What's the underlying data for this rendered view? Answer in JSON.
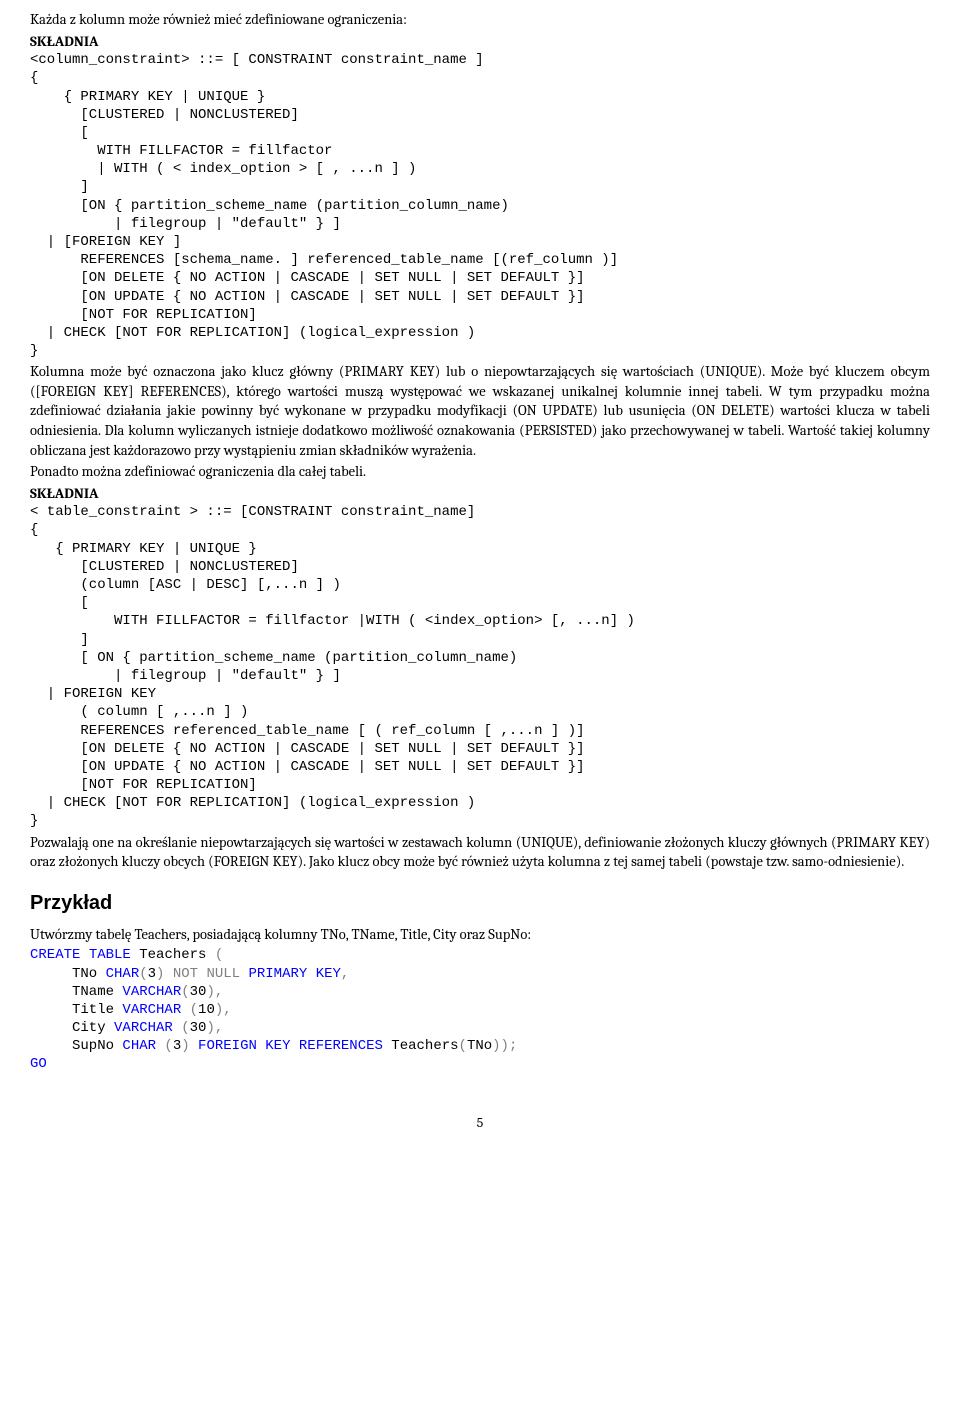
{
  "p1": "Każda z kolumn może również mieć zdefiniowane ograniczenia:",
  "skladnia": "SKŁADNIA",
  "code1": "<column_constraint> ::= [ CONSTRAINT constraint_name ]\n{\n    { PRIMARY KEY | UNIQUE }\n      [CLUSTERED | NONCLUSTERED]\n      [\n        WITH FILLFACTOR = fillfactor\n        | WITH ( < index_option > [ , ...n ] )\n      ]\n      [ON { partition_scheme_name (partition_column_name)\n          | filegroup | \"default\" } ]\n  | [FOREIGN KEY ]\n      REFERENCES [schema_name. ] referenced_table_name [(ref_column )]\n      [ON DELETE { NO ACTION | CASCADE | SET NULL | SET DEFAULT }]\n      [ON UPDATE { NO ACTION | CASCADE | SET NULL | SET DEFAULT }]\n      [NOT FOR REPLICATION]\n  | CHECK [NOT FOR REPLICATION] (logical_expression )\n}",
  "p2": "Kolumna może być oznaczona jako klucz główny (PRIMARY KEY) lub o niepowtarzających się wartościach (UNIQUE). Może być kluczem obcym ([FOREIGN KEY] REFERENCES), którego wartości muszą występować we wskazanej unikalnej kolumnie innej tabeli. W tym przypadku można zdefiniować działania jakie powinny być wykonane w przypadku modyfikacji (ON UPDATE) lub usunięcia (ON DELETE) wartości klucza w tabeli odniesienia. Dla kolumn wyliczanych istnieje dodatkowo możliwość oznakowania (PERSISTED) jako przechowywanej w tabeli. Wartość takiej kolumny obliczana jest każdorazowo przy wystąpieniu zmian składników wyrażenia.",
  "p3": "Ponadto można zdefiniować ograniczenia dla całej tabeli.",
  "code2": "< table_constraint > ::= [CONSTRAINT constraint_name]\n{\n   { PRIMARY KEY | UNIQUE }\n      [CLUSTERED | NONCLUSTERED]\n      (column [ASC | DESC] [,...n ] )\n      [\n          WITH FILLFACTOR = fillfactor |WITH ( <index_option> [, ...n] )\n      ]\n      [ ON { partition_scheme_name (partition_column_name)\n          | filegroup | \"default\" } ]\n  | FOREIGN KEY\n      ( column [ ,...n ] )\n      REFERENCES referenced_table_name [ ( ref_column [ ,...n ] )]\n      [ON DELETE { NO ACTION | CASCADE | SET NULL | SET DEFAULT }]\n      [ON UPDATE { NO ACTION | CASCADE | SET NULL | SET DEFAULT }]\n      [NOT FOR REPLICATION]\n  | CHECK [NOT FOR REPLICATION] (logical_expression )\n}",
  "p4": "Pozwalają one na określanie niepowtarzających się wartości w zestawach kolumn (UNIQUE), definiowanie złożonych kluczy głównych (PRIMARY KEY) oraz złożonych kluczy obcych (FOREIGN KEY). Jako klucz obcy może być również użyta kolumna z tej samej tabeli (powstaje tzw. samo-odniesienie).",
  "h2": "Przykład",
  "p5": "Utwórzmy tabelę Teachers, posiadającą kolumny TNo, TName, Title, City oraz SupNo:",
  "sql": {
    "l1a": "CREATE",
    "l1b": " TABLE",
    "l1c": " Teachers ",
    "l1d": "(",
    "l2a": "     TNo ",
    "l2b": "CHAR",
    "l2c": "(",
    "l2d": "3",
    "l2e": ")",
    "l2f": " NOT",
    "l2g": " NULL",
    "l2h": " PRIMARY",
    "l2i": " KEY",
    "l2j": ",",
    "l3a": "     TName ",
    "l3b": "VARCHAR",
    "l3c": "(",
    "l3d": "30",
    "l3e": "),",
    "l4a": "     Title ",
    "l4b": "VARCHAR",
    "l4c": " (",
    "l4d": "10",
    "l4e": "),",
    "l5a": "     City ",
    "l5b": "VARCHAR",
    "l5c": " (",
    "l5d": "30",
    "l5e": "),",
    "l6a": "     SupNo ",
    "l6b": "CHAR",
    "l6c": " (",
    "l6d": "3",
    "l6e": ")",
    "l6f": " FOREIGN",
    "l6g": " KEY",
    "l6h": " REFERENCES",
    "l6i": " Teachers",
    "l6j": "(",
    "l6k": "TNo",
    "l6l": "));",
    "l7": "GO"
  },
  "pagenum": "5"
}
